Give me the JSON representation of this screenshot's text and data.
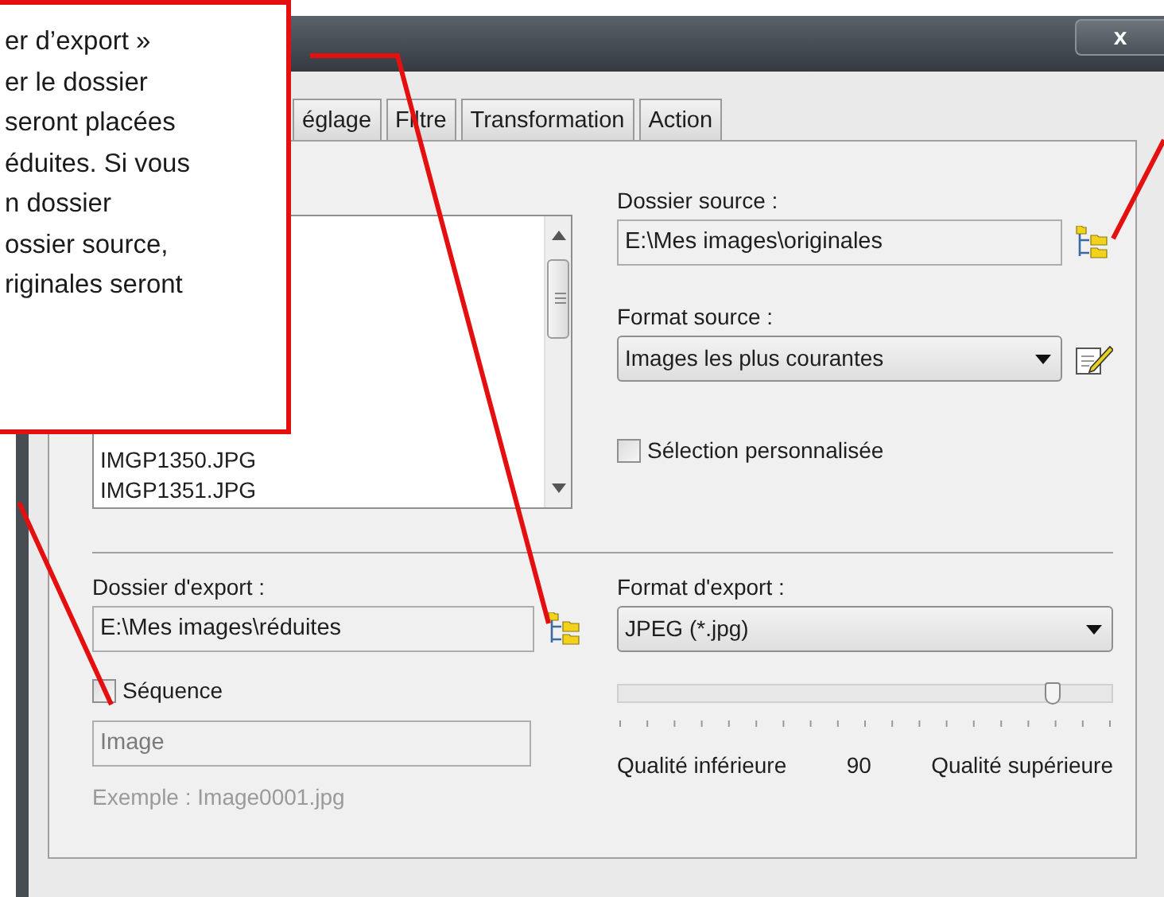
{
  "callout": {
    "lines": [
      "er d’export »",
      "er le dossier",
      "seront placées",
      "éduites. Si vous",
      "n dossier",
      "ossier source,",
      "riginales seront"
    ]
  },
  "window": {
    "close_label": "x"
  },
  "tabs": [
    {
      "label": "églage",
      "selected": false
    },
    {
      "label": "Filtre",
      "selected": false
    },
    {
      "label": "Transformation",
      "selected": false
    },
    {
      "label": "Action",
      "selected": false
    }
  ],
  "file_list": {
    "items": [
      "IMGP1350.JPG",
      "IMGP1351.JPG"
    ]
  },
  "source_folder": {
    "label": "Dossier source :",
    "value": "E:\\Mes images\\originales"
  },
  "source_format": {
    "label": "Format source :",
    "value": "Images les plus courantes"
  },
  "custom_selection": {
    "label": "Sélection personnalisée",
    "checked": false
  },
  "export_folder": {
    "label": "Dossier d'export :",
    "value": "E:\\Mes images\\réduites"
  },
  "sequence": {
    "label": "Séquence",
    "checked": false
  },
  "sequence_name": {
    "value": "Image",
    "disabled": true
  },
  "example": "Exemple : Image0001.jpg",
  "export_format": {
    "label": "Format d'export :",
    "value": "JPEG (*.jpg)"
  },
  "quality": {
    "level": 0.88,
    "low_label": "Qualité inférieure",
    "value": "90",
    "high_label": "Qualité supérieure"
  }
}
